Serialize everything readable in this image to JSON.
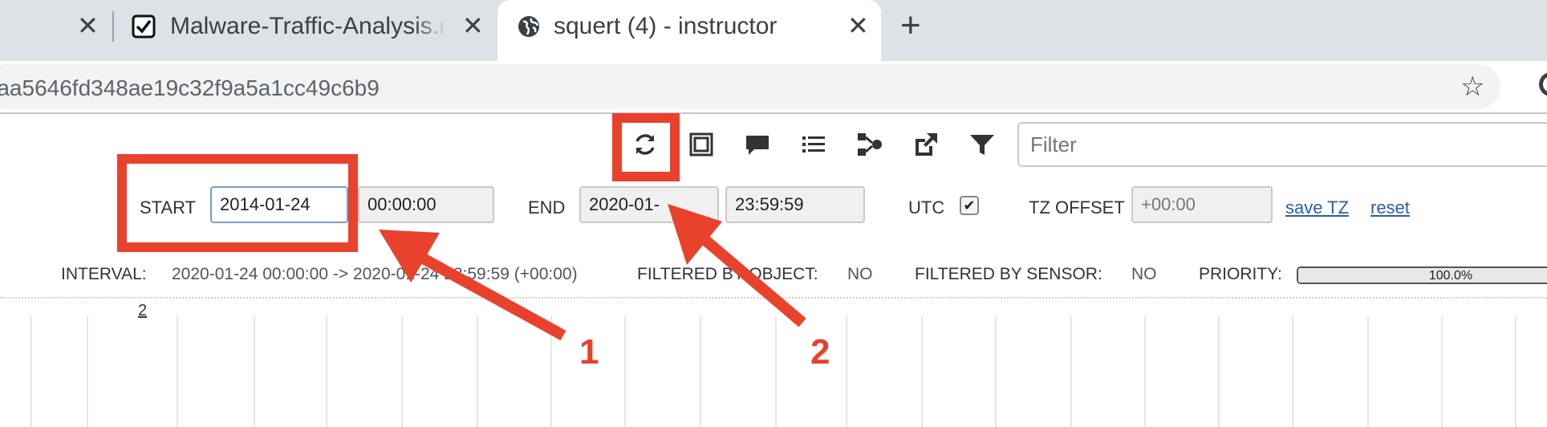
{
  "browser": {
    "tabs": [
      {
        "title": "",
        "active": false
      },
      {
        "title": "Malware-Traffic-Analysis.n",
        "active": false
      },
      {
        "title": "squert (4) - instructor",
        "active": true
      }
    ],
    "new_tab_label": "+",
    "close_glyph": "✕",
    "url": "=aa5646fd348ae19c32f9a5a1cc49c6b9",
    "icons": [
      "checkbox-favicon-icon",
      "globe-favicon-icon",
      "bookmark-star-icon",
      "profile-icon"
    ]
  },
  "toolbar": {
    "icons": [
      "refresh-icon",
      "square-icon",
      "comment-icon",
      "list-icon",
      "nodes-icon",
      "external-link-icon",
      "funnel-icon"
    ],
    "filter_placeholder": "Filter"
  },
  "date_range": {
    "start_label": "START",
    "start_date": "2014-01-24",
    "start_time": "00:00:00",
    "end_label": "END",
    "end_date": "2020-01-",
    "end_time": "23:59:59",
    "utc_label": "UTC",
    "utc_checked": true,
    "utc_check_glyph": "✔",
    "tz_label": "TZ OFFSET",
    "tz_value": "+00:00",
    "save_tz": "save TZ",
    "reset": "reset"
  },
  "status": {
    "interval_label": "INTERVAL:",
    "interval_value": "2020-01-24 00:00:00 -> 2020-01-24 23:59:59 (+00:00)",
    "filtered_object_label": "FILTERED BY OBJECT:",
    "filtered_object_value": "NO",
    "filtered_sensor_label": "FILTERED BY SENSOR:",
    "filtered_sensor_value": "NO",
    "priority_label": "PRIORITY:",
    "priority_text": "100.0%",
    "priority_fraction": 1.0
  },
  "grid": {
    "count_label": "2"
  },
  "annotations": {
    "label_1": "1",
    "label_2": "2",
    "color": "#e8412c"
  }
}
